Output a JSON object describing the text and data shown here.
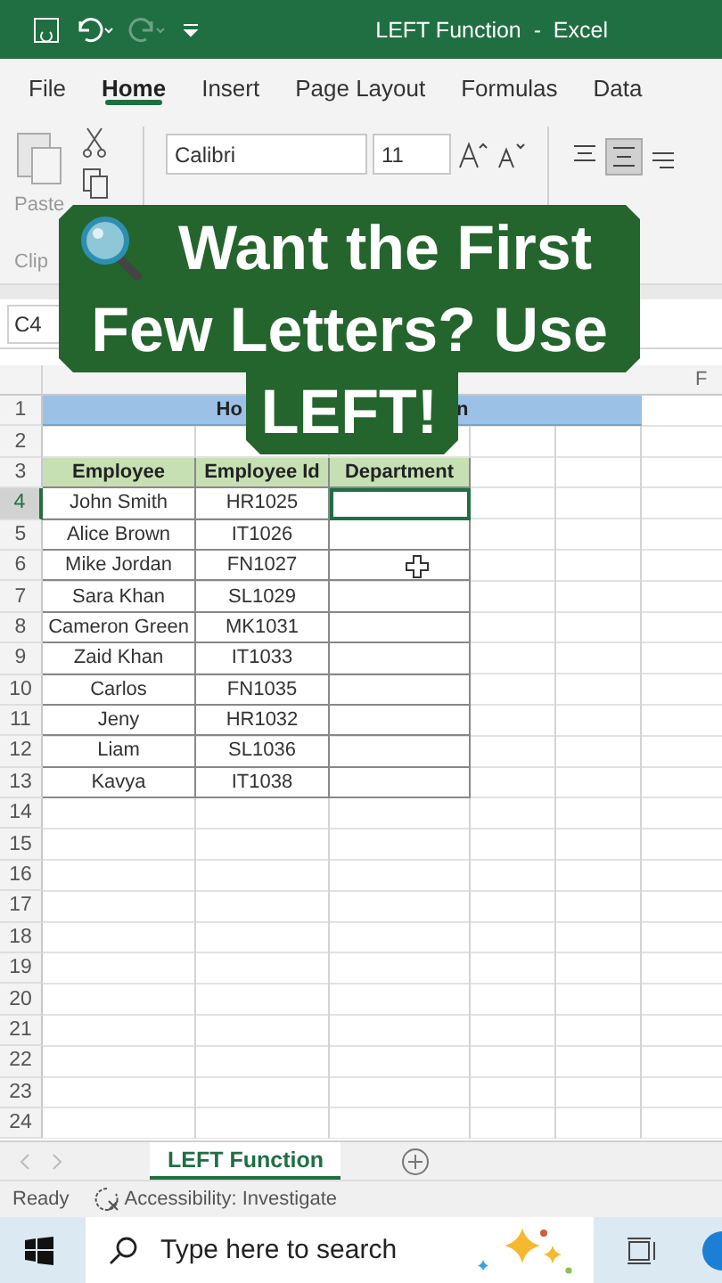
{
  "window": {
    "title": "LEFT Function  -  Excel",
    "redo_disabled": true
  },
  "ribbon_tabs": [
    {
      "label": "File",
      "selected": false
    },
    {
      "label": "Home",
      "selected": true
    },
    {
      "label": "Insert",
      "selected": false
    },
    {
      "label": "Page Layout",
      "selected": false
    },
    {
      "label": "Formulas",
      "selected": false
    },
    {
      "label": "Data",
      "selected": false
    }
  ],
  "ribbon": {
    "paste_label": "Paste",
    "group_label": "Clip",
    "font_name": "Calibri",
    "font_size": "11"
  },
  "name_box": "C4",
  "column_headers": [
    "F"
  ],
  "row_numbers": [
    {
      "label": "1",
      "selected": false
    },
    {
      "label": "2",
      "selected": false
    },
    {
      "label": "3",
      "selected": false
    },
    {
      "label": "4",
      "selected": true
    },
    {
      "label": "5",
      "selected": false
    },
    {
      "label": "6",
      "selected": false
    },
    {
      "label": "7",
      "selected": false
    },
    {
      "label": "8",
      "selected": false
    },
    {
      "label": "9",
      "selected": false
    },
    {
      "label": "10",
      "selected": false
    },
    {
      "label": "11",
      "selected": false
    },
    {
      "label": "12",
      "selected": false
    },
    {
      "label": "13",
      "selected": false
    },
    {
      "label": "14",
      "selected": false
    },
    {
      "label": "15",
      "selected": false
    },
    {
      "label": "16",
      "selected": false
    },
    {
      "label": "17",
      "selected": false
    },
    {
      "label": "18",
      "selected": false
    },
    {
      "label": "19",
      "selected": false
    },
    {
      "label": "20",
      "selected": false
    },
    {
      "label": "21",
      "selected": false
    },
    {
      "label": "22",
      "selected": false
    },
    {
      "label": "23",
      "selected": false
    },
    {
      "label": "24",
      "selected": false
    }
  ],
  "title_fragments": [
    "Ho",
    "n"
  ],
  "table": {
    "columns": [
      "Employee",
      "Employee Id",
      "Department"
    ],
    "rows": [
      {
        "name": "John Smith",
        "id": "HR1025",
        "selected": true
      },
      {
        "name": "Alice Brown",
        "id": "IT1026",
        "selected": false
      },
      {
        "name": "Mike Jordan",
        "id": "FN1027",
        "selected": false
      },
      {
        "name": "Sara Khan",
        "id": "SL1029",
        "selected": false
      },
      {
        "name": "Cameron Green",
        "id": "MK1031",
        "selected": false
      },
      {
        "name": "Zaid Khan",
        "id": "IT1033",
        "selected": false
      },
      {
        "name": "Carlos",
        "id": "FN1035",
        "selected": false
      },
      {
        "name": "Jeny",
        "id": "HR1032",
        "selected": false
      },
      {
        "name": "Liam",
        "id": "SL1036",
        "selected": false
      },
      {
        "name": "Kavya",
        "id": "IT1038",
        "selected": false
      }
    ]
  },
  "overlay": {
    "text": "Want the First Few Letters? Use LEFT!"
  },
  "sheet_tabs": [
    {
      "label": "LEFT Function",
      "selected": true
    }
  ],
  "status_bar": {
    "ready": "Ready",
    "accessibility": "Accessibility: Investigate"
  },
  "taskbar": {
    "search_placeholder": "Type here to search"
  }
}
